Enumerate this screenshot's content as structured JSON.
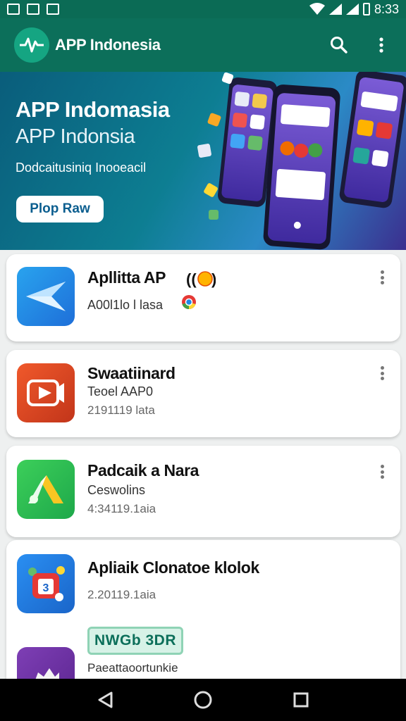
{
  "status_bar": {
    "time": "8:33"
  },
  "app_bar": {
    "title": "APP Indonesia"
  },
  "hero": {
    "title": "APP Indomasia",
    "subtitle": "APP Indonsia",
    "description": "Dodcaitusiniq Inooeacil",
    "button_label": "Plop Raw"
  },
  "apps": [
    {
      "name": "Apllitta AP",
      "line1": "A00l1lo l lasa",
      "line2": ""
    },
    {
      "name": "Swaatiinard",
      "line1": "Teoel AAP0",
      "line2": "2191119 lata"
    },
    {
      "name": "Padcaik a Nara",
      "line1": "Ceswolins",
      "line2": "4:34119.1aia"
    },
    {
      "name": "Apliaik Clonatoe klolok",
      "line1": "",
      "line2": "2.20119.1aia"
    },
    {
      "name": "",
      "line1": "Paeattaoortunkie",
      "line2": "",
      "badge": "NWGb 3DR"
    }
  ],
  "colors": {
    "app_bar": "#0c6f5a",
    "status_bar": "#0b6b55",
    "accent": "#15a582",
    "hero_gradient_start": "#0a5d7b",
    "hero_gradient_end": "#3b2f8f"
  },
  "icons": [
    "wifi-icon",
    "signal-icon",
    "battery-icon",
    "search-icon",
    "more-vert-icon",
    "back-icon",
    "home-icon",
    "recents-icon"
  ]
}
